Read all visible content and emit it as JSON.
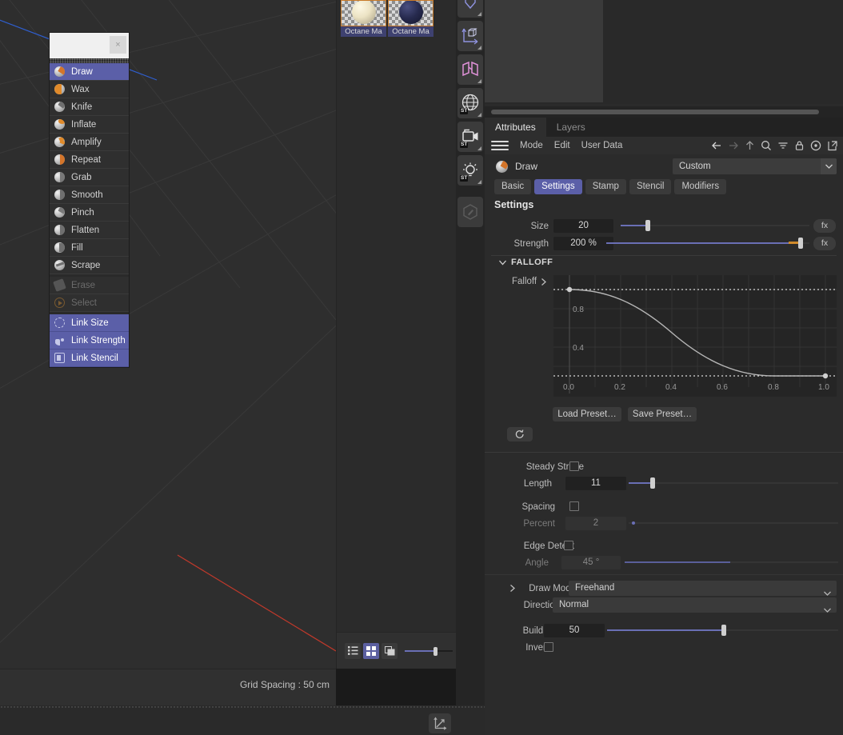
{
  "viewport": {
    "grid_spacing_label": "Grid Spacing : 50 cm",
    "axis_x_color": "#c0392b",
    "axis_z_color": "#2f5fd0",
    "grid_color": "#3b3b3b",
    "background": "#2e2e2e"
  },
  "material_manager": {
    "materials": [
      {
        "label": "Octane Ma",
        "sphere_color": "#ece3c4"
      },
      {
        "label": "Octane Ma",
        "sphere_color": "#262a4e"
      }
    ],
    "view_toggles": [
      {
        "name": "list-view",
        "active": false
      },
      {
        "name": "grid-view",
        "active": true
      },
      {
        "name": "preview-view",
        "active": false
      }
    ]
  },
  "icon_sidebar": {
    "items": [
      {
        "name": "deformer-icon",
        "badge": ""
      },
      {
        "name": "axis-cube-icon",
        "badge": ""
      },
      {
        "name": "cloth-icon",
        "badge": ""
      },
      {
        "name": "environment-icon",
        "badge": "ST"
      },
      {
        "name": "camera-icon",
        "badge": "ST"
      },
      {
        "name": "light-icon",
        "badge": "ST"
      },
      {
        "name": "sculpt-brush-icon",
        "badge": ""
      }
    ]
  },
  "tool_menu": {
    "close_label": "×",
    "items": [
      {
        "label": "Draw",
        "state": "selected",
        "icon": "brush-draw-icon",
        "ball": "#cdcdcd",
        "accent": "#d4752a"
      },
      {
        "label": "Wax",
        "state": "normal",
        "icon": "brush-wax-icon",
        "ball": "#cdcdcd",
        "accent": "#e08a2a"
      },
      {
        "label": "Knife",
        "state": "normal",
        "icon": "brush-knife-icon",
        "ball": "#cdcdcd",
        "accent": "#8c8c8c"
      },
      {
        "label": "Inflate",
        "state": "normal",
        "icon": "brush-inflate-icon",
        "ball": "#cdcdcd",
        "accent": "#e08a2a"
      },
      {
        "label": "Amplify",
        "state": "normal",
        "icon": "brush-amplify-icon",
        "ball": "#cdcdcd",
        "accent": "#e08a2a"
      },
      {
        "label": "Repeat",
        "state": "normal",
        "icon": "brush-repeat-icon",
        "ball": "#cdcdcd",
        "accent": "#d4752a"
      },
      {
        "label": "Grab",
        "state": "normal",
        "icon": "brush-grab-icon",
        "ball": "#cdcdcd",
        "accent": "#8c8c8c"
      },
      {
        "label": "Smooth",
        "state": "normal",
        "icon": "brush-smooth-icon",
        "ball": "#cdcdcd",
        "accent": "#8c8c8c"
      },
      {
        "label": "Pinch",
        "state": "normal",
        "icon": "brush-pinch-icon",
        "ball": "#cdcdcd",
        "accent": "#8c8c8c"
      },
      {
        "label": "Flatten",
        "state": "normal",
        "icon": "brush-flatten-icon",
        "ball": "#cdcdcd",
        "accent": "#8c8c8c"
      },
      {
        "label": "Fill",
        "state": "normal",
        "icon": "brush-fill-icon",
        "ball": "#cdcdcd",
        "accent": "#8c8c8c"
      },
      {
        "label": "Scrape",
        "state": "normal",
        "icon": "brush-scrape-icon",
        "ball": "#cdcdcd",
        "accent": "#8c8c8c"
      },
      {
        "label": "Erase",
        "state": "disabled",
        "icon": "eraser-icon",
        "ball": "#5e5e5e",
        "accent": "#5e5e5e"
      },
      {
        "label": "Select",
        "state": "disabled",
        "icon": "select-icon",
        "ball": "#4a4a4a",
        "accent": "#7a5a30"
      },
      {
        "label": "Link Size",
        "state": "link",
        "icon": "link-size-icon",
        "ball": "#b9bce0",
        "accent": "#b9bce0"
      },
      {
        "label": "Link Strength",
        "state": "link",
        "icon": "link-strength-icon",
        "ball": "#b9bce0",
        "accent": "#b9bce0"
      },
      {
        "label": "Link Stencil",
        "state": "link",
        "icon": "link-stencil-icon",
        "ball": "#b9bce0",
        "accent": "#b9bce0"
      }
    ]
  },
  "attributes_panel": {
    "tabs": [
      {
        "label": "Attributes",
        "active": true
      },
      {
        "label": "Layers",
        "active": false
      }
    ],
    "menu": [
      "Mode",
      "Edit",
      "User Data"
    ],
    "toolbar_icons": [
      "back-arrow-icon",
      "forward-arrow-icon",
      "up-arrow-icon",
      "search-icon",
      "filter-icon",
      "lock-icon",
      "record-icon",
      "popout-icon"
    ],
    "object": {
      "name": "Draw",
      "icon": "brush-draw-icon",
      "preset_value": "Custom"
    },
    "subtabs": [
      {
        "label": "Basic",
        "active": false
      },
      {
        "label": "Settings",
        "active": true
      },
      {
        "label": "Stamp",
        "active": false
      },
      {
        "label": "Stencil",
        "active": false
      },
      {
        "label": "Modifiers",
        "active": false
      }
    ],
    "settings": {
      "heading": "Settings",
      "size": {
        "label": "Size",
        "value": "20",
        "slider_percent": 13,
        "fx_label": "fx"
      },
      "strength": {
        "label": "Strength",
        "value": "200 %",
        "slider_percent": 98,
        "fx_label": "fx"
      }
    },
    "falloff": {
      "section_label": "FALLOFF",
      "row_label": "Falloff",
      "load_preset_label": "Load Preset…",
      "save_preset_label": "Save Preset…",
      "reset_icon": "reset-icon"
    },
    "stroke": {
      "steady_stroke": {
        "label": "Steady Stroke",
        "checked": false
      },
      "length": {
        "label": "Length",
        "value": "11",
        "slider_percent": 11
      },
      "spacing": {
        "label": "Spacing",
        "checked": false
      },
      "percent": {
        "label": "Percent",
        "value": "2",
        "slider_percent": 2,
        "disabled": true
      },
      "edge_detect": {
        "label": "Edge Detect",
        "checked": false
      },
      "angle": {
        "label": "Angle",
        "value": "45 °",
        "slider_percent": 50,
        "disabled": true
      }
    },
    "mode": {
      "draw_mode": {
        "label": "Draw Mode",
        "value": "Freehand"
      },
      "direction": {
        "label": "Direction",
        "value": "Normal"
      },
      "buildup": {
        "label": "Buildup",
        "value": "50",
        "slider_percent": 50
      },
      "invert": {
        "label": "Invert",
        "checked": false
      }
    }
  },
  "chart_data": {
    "type": "line",
    "title": "Falloff",
    "xlabel": "",
    "ylabel": "",
    "xlim": [
      0.0,
      1.0
    ],
    "ylim": [
      0.0,
      1.0
    ],
    "xticks": [
      "0.0",
      "0.2",
      "0.4",
      "0.6",
      "0.8",
      "1.0"
    ],
    "yticks": [
      "0.4",
      "0.8"
    ],
    "grid": true,
    "legend": "none",
    "line_color": "#b6b6b6",
    "points": [
      {
        "x": 0.0,
        "y": 1.0,
        "knot": true
      },
      {
        "x": 0.1,
        "y": 0.985
      },
      {
        "x": 0.2,
        "y": 0.93
      },
      {
        "x": 0.3,
        "y": 0.84
      },
      {
        "x": 0.4,
        "y": 0.69
      },
      {
        "x": 0.5,
        "y": 0.5
      },
      {
        "x": 0.6,
        "y": 0.31
      },
      {
        "x": 0.7,
        "y": 0.16
      },
      {
        "x": 0.8,
        "y": 0.07
      },
      {
        "x": 0.9,
        "y": 0.015
      },
      {
        "x": 1.0,
        "y": 0.0,
        "knot": true
      }
    ]
  }
}
